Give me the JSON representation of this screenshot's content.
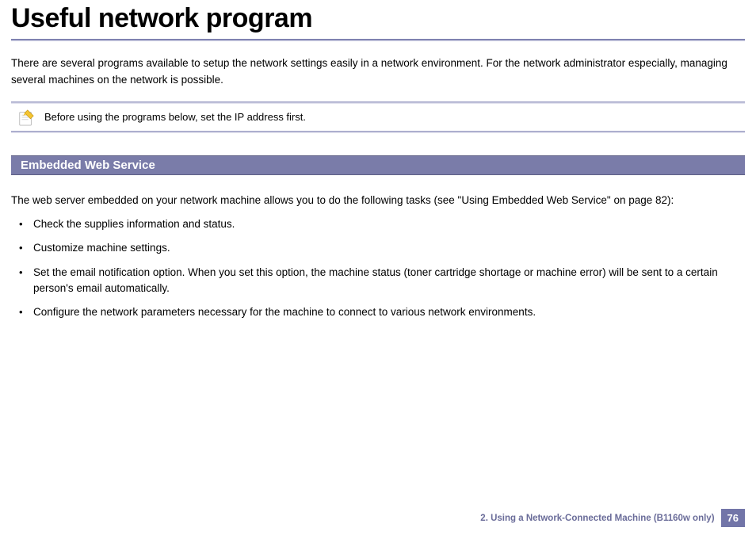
{
  "title": "Useful network program",
  "intro": "There are several programs available to setup the network settings easily in a network environment. For the network administrator especially, managing several machines on the network is possible.",
  "note": {
    "text": "Before using the programs below, set the IP address first."
  },
  "section": {
    "heading": "Embedded Web Service",
    "intro": "The web server embedded on your network machine allows you to do the following tasks (see \"Using Embedded Web Service\" on page 82):",
    "bullets": [
      "Check the supplies information and status.",
      "Customize machine settings.",
      "Set the email notification option. When you set this option, the machine status (toner cartridge shortage or machine error) will be sent to a certain person's email automatically.",
      "Configure the network parameters necessary for the machine to connect to various network environments."
    ]
  },
  "footer": {
    "chapter": "2.  Using a Network-Connected Machine (B1160w only)",
    "page": "76"
  }
}
